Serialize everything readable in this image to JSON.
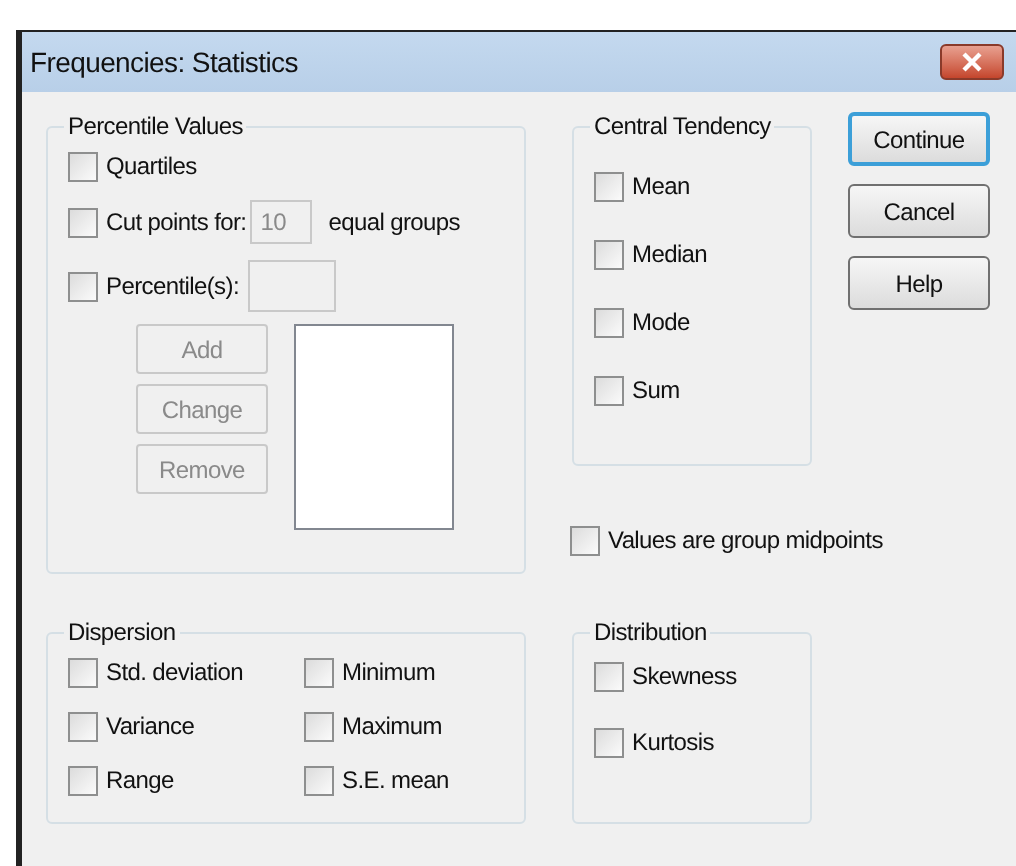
{
  "window": {
    "title": "Frequencies: Statistics"
  },
  "percentile_values": {
    "title": "Percentile Values",
    "options": [
      {
        "kind": "plain",
        "label": "Quartiles",
        "checked": false
      },
      {
        "kind": "count",
        "label": "Cut points for:",
        "value": "10",
        "suffix": "equal groups",
        "checked": false,
        "disabled": true
      },
      {
        "kind": "entry",
        "label": "Percentile(s):",
        "checked": false,
        "disabled": true
      }
    ],
    "buttons": [
      {
        "label": "Add",
        "disabled": true
      },
      {
        "label": "Change",
        "disabled": true
      },
      {
        "label": "Remove",
        "disabled": true
      }
    ]
  },
  "central_tendency": {
    "title": "Central Tendency",
    "options": [
      {
        "label": "Mean",
        "checked": false
      },
      {
        "label": "Median",
        "checked": false
      },
      {
        "label": "Mode",
        "checked": false
      },
      {
        "label": "Sum",
        "checked": false
      }
    ]
  },
  "group_midpoints": {
    "label": "Values are group midpoints",
    "checked": false
  },
  "dispersion": {
    "title": "Dispersion",
    "options": [
      {
        "label": "Std. deviation",
        "checked": false
      },
      {
        "label": "Minimum",
        "checked": false
      },
      {
        "label": "Variance",
        "checked": false
      },
      {
        "label": "Maximum",
        "checked": false
      },
      {
        "label": "Range",
        "checked": false
      },
      {
        "label": "S.E. mean",
        "checked": false
      }
    ]
  },
  "distribution": {
    "title": "Distribution",
    "options": [
      {
        "label": "Skewness",
        "checked": false
      },
      {
        "label": "Kurtosis",
        "checked": false
      }
    ]
  },
  "buttons": [
    {
      "label": "Continue",
      "default": true
    },
    {
      "label": "Cancel",
      "default": false
    },
    {
      "label": "Help",
      "default": false
    }
  ]
}
